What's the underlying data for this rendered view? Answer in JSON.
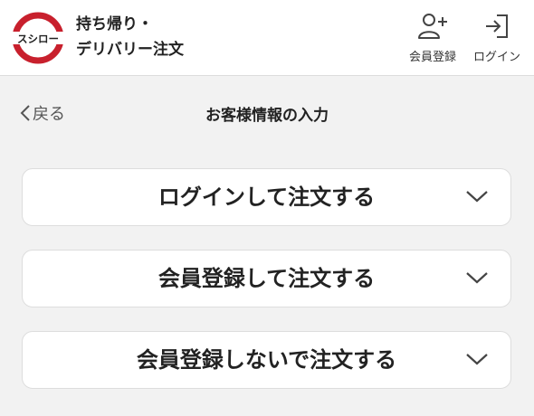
{
  "header": {
    "logo_text": "スシロー",
    "brand_line1": "持ち帰り・",
    "brand_line2": "デリバリー注文",
    "register_label": "会員登録",
    "login_label": "ログイン"
  },
  "nav": {
    "back_label": "戻る",
    "title": "お客様情報の入力"
  },
  "options": [
    {
      "label": "ログインして注文する",
      "icon": "chevron-down-icon"
    },
    {
      "label": "会員登録して注文する",
      "icon": "chevron-down-icon"
    },
    {
      "label": "会員登録しないで注文する",
      "icon": "chevron-down-icon"
    }
  ],
  "colors": {
    "brand_red": "#c8202d",
    "background": "#f2f2f2",
    "card": "#ffffff"
  }
}
